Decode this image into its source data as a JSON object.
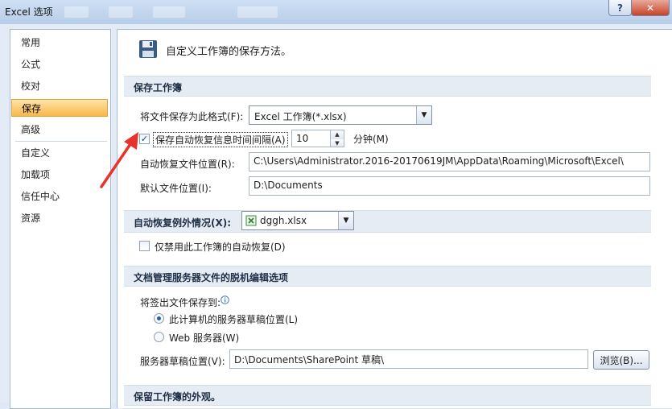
{
  "window": {
    "title": "Excel 选项",
    "help_label": "?",
    "close_label": "✕"
  },
  "sidebar": {
    "items": [
      {
        "label": "常用",
        "active": false
      },
      {
        "label": "公式",
        "active": false
      },
      {
        "label": "校对",
        "active": false
      },
      {
        "label": "保存",
        "active": true
      },
      {
        "label": "高级",
        "active": false
      },
      {
        "label": "自定义",
        "active": false
      },
      {
        "label": "加载项",
        "active": false
      },
      {
        "label": "信任中心",
        "active": false
      },
      {
        "label": "资源",
        "active": false
      }
    ]
  },
  "header": {
    "icon": "floppy-disk-icon",
    "text": "自定义工作簿的保存方法。"
  },
  "save_section": {
    "title": "保存工作簿",
    "format_label": "将文件保存为此格式(F):",
    "format_value": "Excel 工作簿(*.xlsx)",
    "autorecover_label": "保存自动恢复信息时间间隔(A)",
    "autorecover_checked": true,
    "autorecover_minutes": "10",
    "minutes_label": "分钟(M)",
    "autorecover_location_label": "自动恢复文件位置(R):",
    "autorecover_location_value": "C:\\Users\\Administrator.2016-20170619JM\\AppData\\Roaming\\Microsoft\\Excel\\",
    "default_location_label": "默认文件位置(I):",
    "default_location_value": "D:\\Documents"
  },
  "exceptions_section": {
    "title": "自动恢复例外情况(X):",
    "workbook_value": "dggh.xlsx",
    "disable_label": "仅禁用此工作簿的自动恢复(D)",
    "disable_checked": false
  },
  "offline_section": {
    "title": "文档管理服务器文件的脱机编辑选项",
    "checkout_label": "将签出文件保存到:",
    "option_local_label": "此计算机的服务器草稿位置(L)",
    "option_local_selected": true,
    "option_web_label": "Web 服务器(W)",
    "option_web_selected": false,
    "drafts_location_label": "服务器草稿位置(V):",
    "drafts_location_value": "D:\\Documents\\SharePoint 草稿\\",
    "browse_label": "浏览(B)..."
  },
  "appearance_section": {
    "title": "保留工作簿的外观。"
  },
  "colors": {
    "active_nav": "#f9b64a",
    "section_band": "#e6ecf4",
    "annotation_arrow": "#e8322b"
  }
}
